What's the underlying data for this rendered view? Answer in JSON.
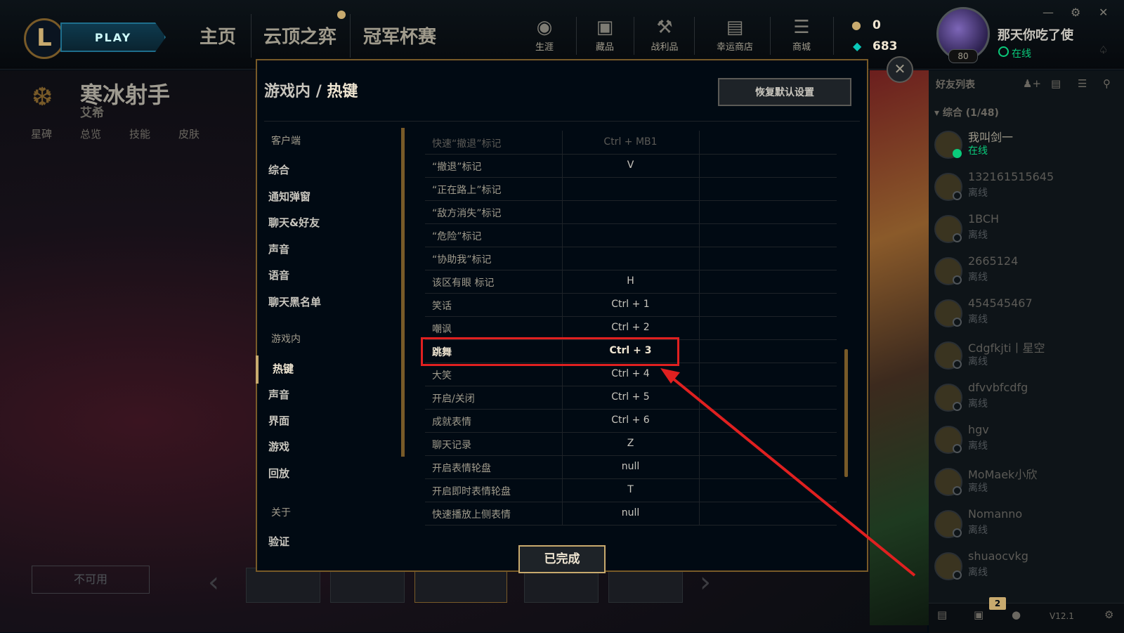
{
  "topbar": {
    "play_label": "PLAY",
    "tabs": [
      "主页",
      "云顶之弈",
      "冠军杯赛"
    ],
    "icons": [
      {
        "label": "生涯",
        "icon": "profile-icon"
      },
      {
        "label": "藏品",
        "icon": "collection-icon"
      },
      {
        "label": "战利品",
        "icon": "loot-icon"
      },
      {
        "label": "幸运商店",
        "icon": "lucky-store-icon"
      },
      {
        "label": "商城",
        "icon": "store-icon"
      }
    ],
    "currency": {
      "orange_essence": "0",
      "blue_essence": "683"
    },
    "user": {
      "name": "那天你吃了使",
      "status": "在线",
      "level": "80"
    }
  },
  "champion": {
    "name": "寒冰射手",
    "subtitle": "艾希",
    "tabs": [
      "星碑",
      "总览",
      "技能",
      "皮肤"
    ],
    "unavailable_label": "不可用"
  },
  "dialog": {
    "breadcrumb_parent": "游戏内",
    "breadcrumb_sep": "/",
    "breadcrumb_current": "热键",
    "reset_label": "恢复默认设置",
    "done_label": "已完成",
    "menu": {
      "client_section": "客户端",
      "client_items": [
        "综合",
        "通知弹窗",
        "聊天&好友",
        "声音",
        "语音",
        "聊天黑名单"
      ],
      "ingame_section": "游戏内",
      "ingame_items": [
        "热键",
        "声音",
        "界面",
        "游戏",
        "回放"
      ],
      "about_section": "关于",
      "about_items": [
        "验证"
      ]
    },
    "hotkeys": [
      {
        "action": "快速“撤退”标记",
        "key": "Ctrl + MB1"
      },
      {
        "action": "“撤退”标记",
        "key": "V"
      },
      {
        "action": "“正在路上”标记",
        "key": ""
      },
      {
        "action": "“敌方消失”标记",
        "key": ""
      },
      {
        "action": "“危险”标记",
        "key": ""
      },
      {
        "action": "“协助我”标记",
        "key": ""
      },
      {
        "action": "该区有眼 标记",
        "key": "H"
      },
      {
        "action": "笑话",
        "key": "Ctrl + 1"
      },
      {
        "action": "嘲讽",
        "key": "Ctrl + 2"
      },
      {
        "action": "跳舞",
        "key": "Ctrl + 3"
      },
      {
        "action": "大笑",
        "key": "Ctrl + 4"
      },
      {
        "action": "开启/关闭",
        "key": "Ctrl + 5"
      },
      {
        "action": "成就表情",
        "key": "Ctrl + 6"
      },
      {
        "action": "聊天记录",
        "key": "Z"
      },
      {
        "action": "开启表情轮盘",
        "key": "null"
      },
      {
        "action": "开启即时表情轮盘",
        "key": "T"
      },
      {
        "action": "快速播放上侧表情",
        "key": "null"
      }
    ],
    "highlighted_action": "跳舞"
  },
  "friends": {
    "title": "好友列表",
    "group": "综合 (1/48)",
    "list": [
      {
        "name": "我叫剑一",
        "status": "在线",
        "online": true
      },
      {
        "name": "132161515645",
        "status": "离线",
        "online": false
      },
      {
        "name": "1BCH",
        "status": "离线",
        "online": false
      },
      {
        "name": "2665124",
        "status": "离线",
        "online": false
      },
      {
        "name": "454545467",
        "status": "离线",
        "online": false
      },
      {
        "name": "Cdgfkjti丨星空",
        "status": "离线",
        "online": false
      },
      {
        "name": "dfvvbfcdfg",
        "status": "离线",
        "online": false
      },
      {
        "name": "hgv",
        "status": "离线",
        "online": false
      },
      {
        "name": "MoMaek小欣",
        "status": "离线",
        "online": false
      },
      {
        "name": "Nomanno",
        "status": "离线",
        "online": false
      },
      {
        "name": "shuaocvkg",
        "status": "离线",
        "online": false
      }
    ],
    "badge_count": "2",
    "version": "V12.1"
  },
  "colors": {
    "gold": "#c8aa6e",
    "highlight_red": "#e02020",
    "online_green": "#0acb7b"
  }
}
